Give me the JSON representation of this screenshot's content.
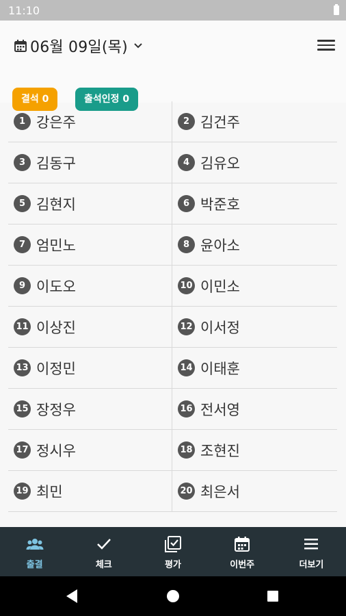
{
  "status_bar": {
    "time": "11:10"
  },
  "header": {
    "date": "06월 09일(목)",
    "chips": {
      "absent": "결석 0",
      "approved": "출석인정 0"
    }
  },
  "students": [
    {
      "num": "1",
      "name": "강은주"
    },
    {
      "num": "2",
      "name": "김건주"
    },
    {
      "num": "3",
      "name": "김동구"
    },
    {
      "num": "4",
      "name": "김유오"
    },
    {
      "num": "5",
      "name": "김현지"
    },
    {
      "num": "6",
      "name": "박준호"
    },
    {
      "num": "7",
      "name": "엄민노"
    },
    {
      "num": "8",
      "name": "윤아소"
    },
    {
      "num": "9",
      "name": "이도오"
    },
    {
      "num": "10",
      "name": "이민소"
    },
    {
      "num": "11",
      "name": "이상진"
    },
    {
      "num": "12",
      "name": "이서정"
    },
    {
      "num": "13",
      "name": "이정민"
    },
    {
      "num": "14",
      "name": "이태훈"
    },
    {
      "num": "15",
      "name": "장정우"
    },
    {
      "num": "16",
      "name": "전서영"
    },
    {
      "num": "17",
      "name": "정시우"
    },
    {
      "num": "18",
      "name": "조현진"
    },
    {
      "num": "19",
      "name": "최민"
    },
    {
      "num": "20",
      "name": "최은서"
    }
  ],
  "bottom_nav": {
    "tabs": [
      {
        "label": "출결",
        "icon": "people-icon"
      },
      {
        "label": "체크",
        "icon": "check-icon"
      },
      {
        "label": "평가",
        "icon": "checkbox-icon"
      },
      {
        "label": "이번주",
        "icon": "calendar-icon"
      },
      {
        "label": "더보기",
        "icon": "menu-icon"
      }
    ]
  },
  "colors": {
    "absent_chip": "#f5a100",
    "approved_chip": "#199c8a",
    "nav_bg": "#263238",
    "nav_active": "#7ec4e2"
  }
}
